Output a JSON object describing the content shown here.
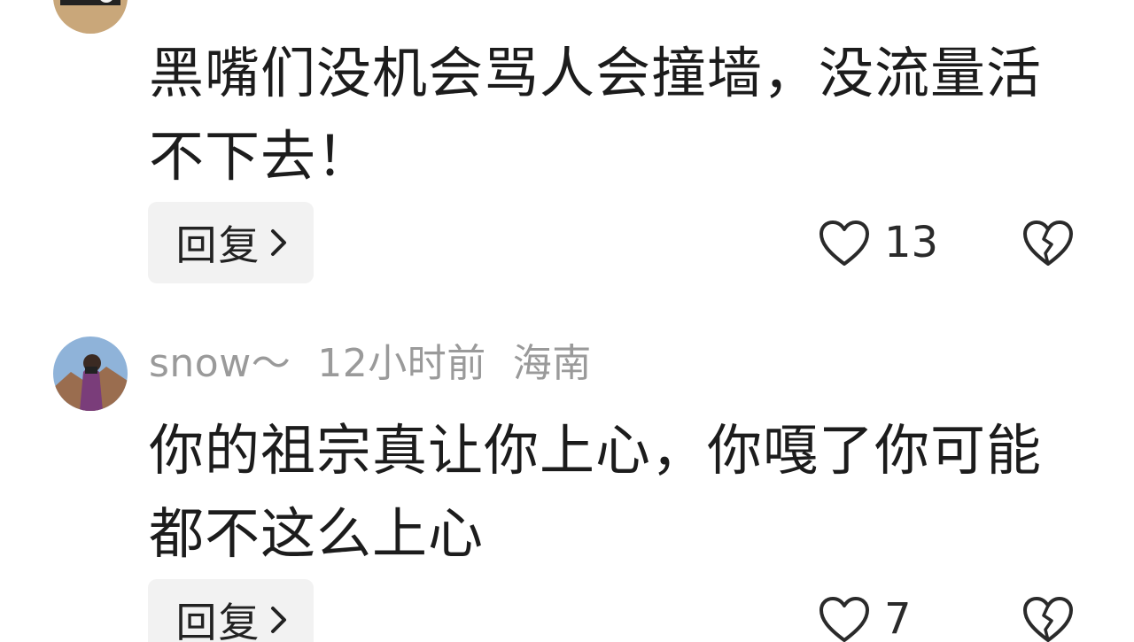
{
  "comments": [
    {
      "meta": {
        "username": "",
        "time": "",
        "location": ""
      },
      "text": "黑嘴们没机会骂人会撞墙，没流量活不下去！",
      "reply_label": "回复",
      "like_count": "13"
    },
    {
      "meta": {
        "username": "snow～",
        "time": "12小时前",
        "location": "海南"
      },
      "text": "你的祖宗真让你上心，你嘎了你可能都不这么上心",
      "reply_label": "回复",
      "like_count": "7"
    }
  ],
  "icons": {
    "like": "heart-outline-icon",
    "dislike": "broken-heart-icon",
    "reply_chevron": "chevron-right-icon"
  },
  "colors": {
    "text_primary": "#1c1c1c",
    "text_meta": "#9a9a9a",
    "reply_bg": "#f2f2f2"
  }
}
